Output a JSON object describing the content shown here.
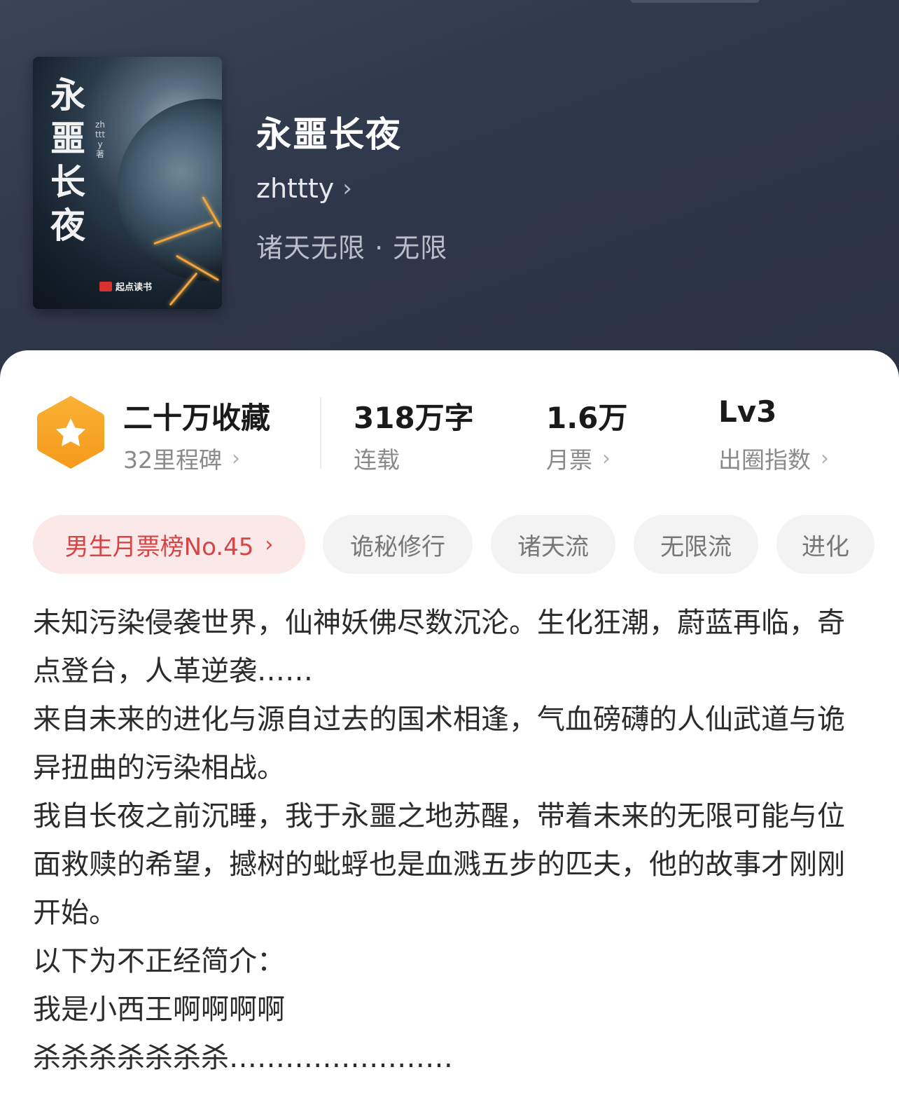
{
  "book": {
    "title": "永噩长夜",
    "author": "zhttty",
    "genre": "诸天无限 · 无限"
  },
  "cover": {
    "title": "永噩长夜",
    "author": "zhttty",
    "author_suffix": "著",
    "brand": "起点读书"
  },
  "stats": {
    "favorites": {
      "main": "二十万收藏",
      "sub": "32里程碑"
    },
    "words": {
      "main": "318万字",
      "sub": "连载"
    },
    "tickets": {
      "main": "1.6万",
      "sub": "月票"
    },
    "index": {
      "main": "Lv3",
      "sub": "出圈指数"
    }
  },
  "tags": {
    "rank": "男生月票榜No.45",
    "items": [
      "诡秘修行",
      "诸天流",
      "无限流",
      "进化"
    ]
  },
  "description": [
    "未知污染侵袭世界，仙神妖佛尽数沉沦。生化狂潮，蔚蓝再临，奇点登台，人革逆袭……",
    "来自未来的进化与源自过去的国术相逢，气血磅礴的人仙武道与诡异扭曲的污染相战。",
    "我自长夜之前沉睡，我于永噩之地苏醒，带着未来的无限可能与位面救赎的希望，撼树的蚍蜉也是血溅五步的匹夫，他的故事才刚刚开始。",
    "以下为不正经简介：",
    "我是小西王啊啊啊啊",
    "杀杀杀杀杀杀杀……………………"
  ],
  "colors": {
    "header_bg": "#2f374a",
    "rank_tag_text": "#d64545",
    "rank_tag_bg": "#fbe9ea",
    "badge": "#f5a623"
  },
  "icons": {
    "favorites_badge": "star-hexagon-icon",
    "chevron": "chevron-right-icon"
  }
}
